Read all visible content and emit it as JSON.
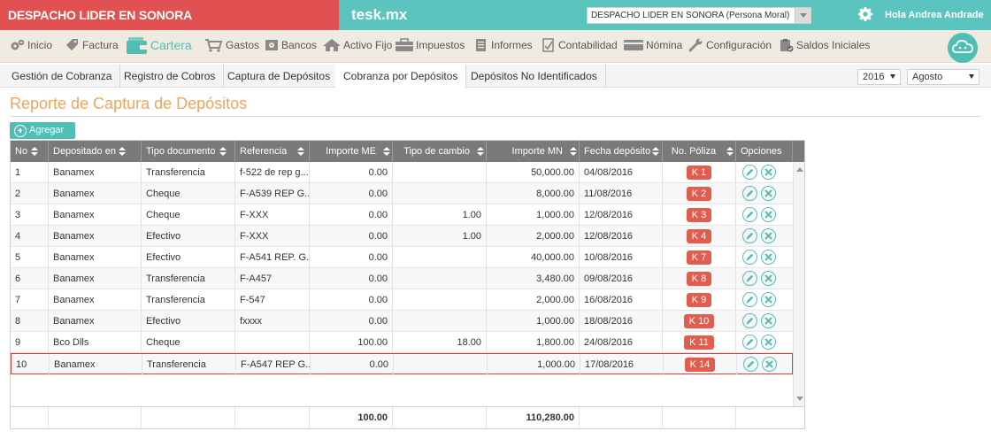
{
  "header": {
    "company_name": "DESPACHO LIDER EN SONORA",
    "brand": "tesk.mx",
    "company_select": "DESPACHO LIDER EN SONORA (Persona Moral)",
    "greeting": "Hola Andrea Andrade"
  },
  "menu": {
    "items": [
      {
        "label": "Inicio",
        "icon": "gears-icon"
      },
      {
        "label": "Factura",
        "icon": "tag-icon"
      },
      {
        "label": "Cartera",
        "icon": "wallet-icon"
      },
      {
        "label": "Gastos",
        "icon": "cart-icon"
      },
      {
        "label": "Bancos",
        "icon": "safe-icon"
      },
      {
        "label": "Activo Fijo",
        "icon": "house-icon"
      },
      {
        "label": "Impuestos",
        "icon": "briefcase-icon"
      },
      {
        "label": "Informes",
        "icon": "document-icon"
      },
      {
        "label": "Contabilidad",
        "icon": "checklist-icon"
      },
      {
        "label": "Nómina",
        "icon": "card-icon"
      },
      {
        "label": "Configuración",
        "icon": "wrench-icon"
      },
      {
        "label": "Saldos Iniciales",
        "icon": "clipboard-icon"
      }
    ],
    "active": "Cartera"
  },
  "subtabs": {
    "items": [
      "Gestión de Cobranza",
      "Registro de Cobros",
      "Captura de Depósitos",
      "Cobranza por Depósitos",
      "Depósitos No Identificados"
    ],
    "active": "Cobranza por Depósitos",
    "year": "2016",
    "month": "Agosto"
  },
  "page": {
    "title": "Reporte de Captura de Depósitos",
    "add_label": "Agregar"
  },
  "table": {
    "columns": [
      "No",
      "Depositado en",
      "Tipo documento",
      "Referencia",
      "Importe ME",
      "Tipo de cambio",
      "Importe MN",
      "Fecha depósito",
      "No. Póliza",
      "Opciones"
    ],
    "rows": [
      {
        "no": "1",
        "banco": "Banamex",
        "tipo": "Transferencia",
        "ref": "f-522 de rep g...",
        "importe_me": "0.00",
        "tipo_cambio": "",
        "importe_mn": "50,000.00",
        "fecha": "04/08/2016",
        "poliza": "K 1"
      },
      {
        "no": "2",
        "banco": "Banamex",
        "tipo": "Cheque",
        "ref": "F-A539 REP G...",
        "importe_me": "0.00",
        "tipo_cambio": "",
        "importe_mn": "8,000.00",
        "fecha": "11/08/2016",
        "poliza": "K 2"
      },
      {
        "no": "3",
        "banco": "Banamex",
        "tipo": "Cheque",
        "ref": "F-XXX",
        "importe_me": "0.00",
        "tipo_cambio": "1.00",
        "importe_mn": "1,000.00",
        "fecha": "12/08/2016",
        "poliza": "K 3"
      },
      {
        "no": "4",
        "banco": "Banamex",
        "tipo": "Efectivo",
        "ref": "F-XXX",
        "importe_me": "0.00",
        "tipo_cambio": "1.00",
        "importe_mn": "2,000.00",
        "fecha": "12/08/2016",
        "poliza": "K 4"
      },
      {
        "no": "5",
        "banco": "Banamex",
        "tipo": "Efectivo",
        "ref": "F-A541 REP. G...",
        "importe_me": "0.00",
        "tipo_cambio": "",
        "importe_mn": "40,000.00",
        "fecha": "10/08/2016",
        "poliza": "K 7"
      },
      {
        "no": "6",
        "banco": "Banamex",
        "tipo": "Transferencia",
        "ref": "F-A457",
        "importe_me": "0.00",
        "tipo_cambio": "",
        "importe_mn": "3,480.00",
        "fecha": "09/08/2016",
        "poliza": "K 8"
      },
      {
        "no": "7",
        "banco": "Banamex",
        "tipo": "Transferencia",
        "ref": "F-547",
        "importe_me": "0.00",
        "tipo_cambio": "",
        "importe_mn": "2,000.00",
        "fecha": "16/08/2016",
        "poliza": "K 9"
      },
      {
        "no": "8",
        "banco": "Banamex",
        "tipo": "Efectivo",
        "ref": "fxxxx",
        "importe_me": "0.00",
        "tipo_cambio": "",
        "importe_mn": "1,000.00",
        "fecha": "18/08/2016",
        "poliza": "K 10"
      },
      {
        "no": "9",
        "banco": "Bco Dlls",
        "tipo": "Cheque",
        "ref": "",
        "importe_me": "100.00",
        "tipo_cambio": "18.00",
        "importe_mn": "1,800.00",
        "fecha": "24/08/2016",
        "poliza": "K 11"
      },
      {
        "no": "10",
        "banco": "Banamex",
        "tipo": "Transferencia",
        "ref": "F-A547 REP G...",
        "importe_me": "0.00",
        "tipo_cambio": "",
        "importe_mn": "1,000.00",
        "fecha": "17/08/2016",
        "poliza": "K 14"
      }
    ],
    "selected_row": "10",
    "totals": {
      "importe_me": "100.00",
      "importe_mn": "110,280.00"
    }
  },
  "colors": {
    "accent": "#4fbfb6",
    "company_bar": "#e25151",
    "title": "#f0a55a",
    "badge": "#e25d4d",
    "header": "#7a7a7a"
  }
}
